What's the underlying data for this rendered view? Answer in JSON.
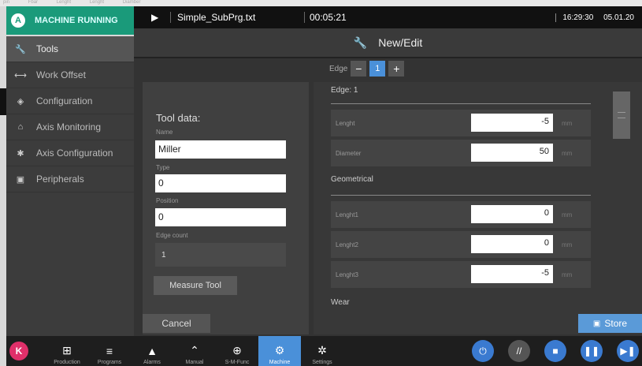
{
  "background_strip": [
    "pin",
    "Fbar",
    "Lenght",
    "Lenght",
    "Diamber"
  ],
  "topbar": {
    "status_icon": "A",
    "status": "MACHINE RUNNING",
    "play_icon": "play-icon",
    "program_file": "Simple_SubPrg.txt",
    "runtime": "00:05:21",
    "time": "16:29:30",
    "date": "05.01.20"
  },
  "sidebar": {
    "items": [
      {
        "label": "Tools",
        "icon": "wrench-icon",
        "glyph": "🔧"
      },
      {
        "label": "Work Offset",
        "icon": "offset-icon",
        "glyph": "⟷"
      },
      {
        "label": "Configuration",
        "icon": "config-icon",
        "glyph": "◈"
      },
      {
        "label": "Axis Monitoring",
        "icon": "monitor-icon",
        "glyph": "⌂"
      },
      {
        "label": "Axis Configuration",
        "icon": "gear-icon",
        "glyph": "✱"
      },
      {
        "label": "Peripherals",
        "icon": "peripheral-icon",
        "glyph": "▣"
      }
    ]
  },
  "header": {
    "title": "New/Edit",
    "icon": "wrench-icon"
  },
  "edge_selector": {
    "label": "Edge",
    "minus": "−",
    "value": "1",
    "plus": "+"
  },
  "tool_data": {
    "title": "Tool data:",
    "name_label": "Name",
    "name_value": "Miller",
    "type_label": "Type",
    "type_value": "0",
    "position_label": "Position",
    "position_value": "0",
    "edge_count_label": "Edge count",
    "edge_count_value": "1",
    "measure_button": "Measure Tool"
  },
  "edge_panel": {
    "edge_title": "Edge: 1",
    "rows_top": [
      {
        "label": "Lenght",
        "value": "-5",
        "unit": "mm"
      },
      {
        "label": "Diameter",
        "value": "50",
        "unit": "mm"
      }
    ],
    "geometrical_title": "Geometrical",
    "rows_geo": [
      {
        "label": "Lenght1",
        "value": "0",
        "unit": "mm"
      },
      {
        "label": "Lenght2",
        "value": "0",
        "unit": "mm"
      },
      {
        "label": "Lenght3",
        "value": "-5",
        "unit": "mm"
      }
    ],
    "wear_title": "Wear"
  },
  "actions": {
    "cancel": "Cancel",
    "store": "Store"
  },
  "bottom": {
    "k_label": "K",
    "tabs": [
      {
        "label": "Production",
        "icon": "production-icon",
        "glyph": "⊞"
      },
      {
        "label": "Programs",
        "icon": "programs-icon",
        "glyph": "≡"
      },
      {
        "label": "Alarms",
        "icon": "alarm-icon",
        "glyph": "▲"
      },
      {
        "label": "Manual",
        "icon": "manual-icon",
        "glyph": "⌃"
      },
      {
        "label": "S-M-Func",
        "icon": "smfunc-icon",
        "glyph": "⊕"
      },
      {
        "label": "Machine",
        "icon": "machine-icon",
        "glyph": "⚙"
      },
      {
        "label": "Settings",
        "icon": "settings-icon",
        "glyph": "✲"
      }
    ],
    "controls": [
      {
        "name": "power-icon",
        "glyph": "⏻"
      },
      {
        "name": "feed-override-icon",
        "glyph": "//"
      },
      {
        "name": "stop-icon",
        "glyph": "■"
      },
      {
        "name": "pause-icon",
        "glyph": "❚❚"
      },
      {
        "name": "step-icon",
        "glyph": "▶❚"
      }
    ]
  }
}
